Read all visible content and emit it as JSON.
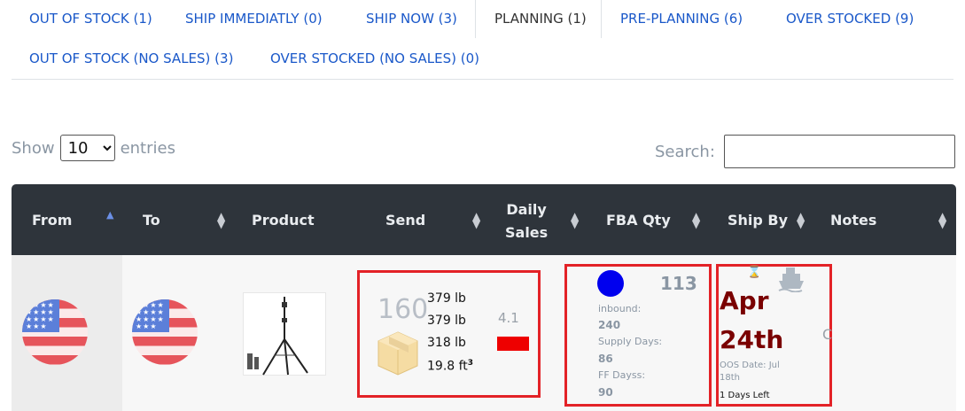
{
  "tabs": [
    {
      "label": "OUT OF STOCK (1)"
    },
    {
      "label": "SHIP IMMEDIATLY (0)"
    },
    {
      "label": "SHIP NOW (3)"
    },
    {
      "label": "PLANNING (1)"
    },
    {
      "label": "PRE-PLANNING (6)"
    },
    {
      "label": "OVER STOCKED (9)"
    },
    {
      "label": "OUT OF STOCK (NO SALES) (3)"
    },
    {
      "label": "OVER STOCKED (NO SALES) (0)"
    }
  ],
  "controls": {
    "show_label": "Show",
    "entries_value": "10",
    "entries_label": "entries",
    "search_label": "Search:",
    "search_value": ""
  },
  "table": {
    "headers": {
      "from": "From",
      "to": "To",
      "product": "Product",
      "send": "Send",
      "daily_line1": "Daily",
      "daily_line2": "Sales",
      "fba": "FBA Qty",
      "shipby": "Ship By",
      "notes": "Notes"
    },
    "row": {
      "send_qty": "160",
      "weights": [
        "379 lb",
        "379 lb",
        "318 lb"
      ],
      "volume": "19.8 ft",
      "volume_sup": "3",
      "daily_sales": "4.1",
      "fba_qty": "113",
      "inbound_label": "inbound:",
      "inbound_value": "240",
      "supply_days_label": "Supply Days:",
      "supply_days_value": "86",
      "ff_days_label": "FF Dayss:",
      "ff_days_value": "90",
      "ship_month": "Apr",
      "ship_day": "24th",
      "oos_date": "OOS Date: Jul 18th",
      "days_left": "1 Days Left",
      "notes_text": "C"
    }
  },
  "colors": {
    "accent": "#1a58c9",
    "header_bg": "#2e343b",
    "highlight_border": "#e32227",
    "date_color": "#7a0000",
    "status_dot": "#0000ee"
  },
  "icons": [
    "chevron-down-icon",
    "sort-asc-icon",
    "sort-icon",
    "us-flag-icon",
    "box-icon",
    "hourglass-icon",
    "ship-icon"
  ]
}
